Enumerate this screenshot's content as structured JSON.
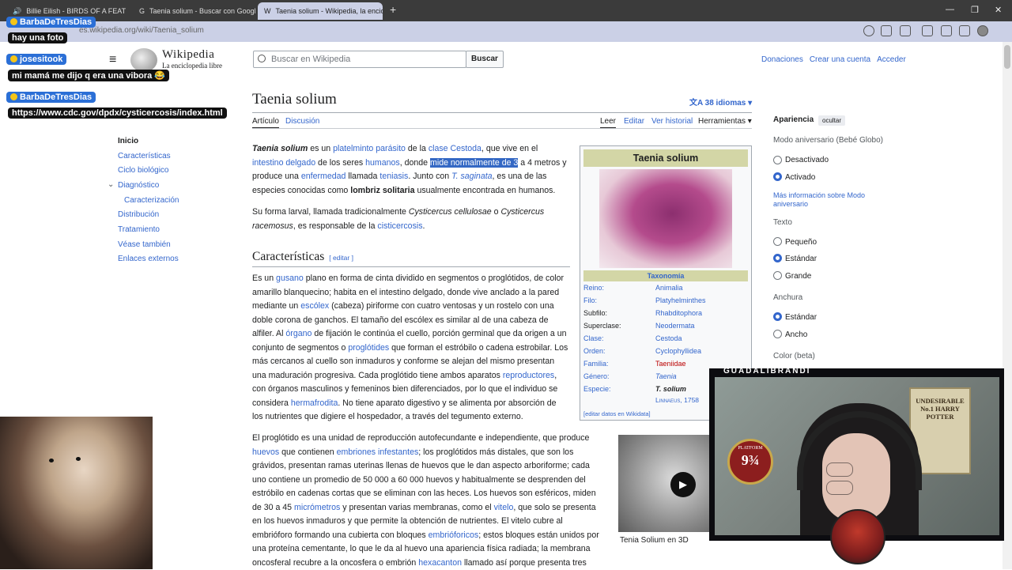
{
  "browser": {
    "tabs": [
      {
        "label": "Billie Eilish - BIRDS OF A FEAT",
        "close": "✕"
      },
      {
        "label": "Taenia solium - Buscar con Google",
        "close": "✕"
      },
      {
        "label": "Taenia solium - Wikipedia, la encic",
        "close": "✕"
      }
    ],
    "new_tab": "+",
    "url": "es.wikipedia.org/wiki/Taenia_solium",
    "window_controls": [
      "—",
      "❐",
      "✕"
    ]
  },
  "header": {
    "menu_glyph": "≡",
    "logo_word": "Wikipedia",
    "logo_tagline": "La enciclopedia libre",
    "search_placeholder": "Buscar en Wikipedia",
    "search_button": "Buscar",
    "links": [
      "Donaciones",
      "Crear una cuenta",
      "Acceder"
    ]
  },
  "article": {
    "title": "Taenia solium",
    "languages": "38 idiomas",
    "tabs_left": [
      "Artículo",
      "Discusión"
    ],
    "tabs_right": [
      "Leer",
      "Editar",
      "Ver historial",
      "Herramientas"
    ]
  },
  "toc": {
    "items": [
      "Inicio",
      "Características",
      "Ciclo biológico",
      "Diagnóstico",
      "Caracterización",
      "Distribución",
      "Tratamiento",
      "Véase también",
      "Enlaces externos"
    ]
  },
  "body": {
    "p1": {
      "a": "Taenia solium",
      "b": " es un ",
      "c": "platelminto parásito",
      "d": " de la ",
      "e": "clase Cestoda",
      "f": ", que vive en el ",
      "g": "intestino delgado",
      "h": " de los seres ",
      "i": "humanos",
      "j": ", donde ",
      "k": "mide normalmente de 3",
      "l": " a 4 metros y produce una ",
      "m": "enfermedad",
      "n": " llamada ",
      "o": "teniasis",
      "q": ". Junto con ",
      "r": "T. saginata",
      "s": ", es una de las especies conocidas como ",
      "t": "lombriz solitaria",
      "u": " usualmente encontrada en humanos."
    },
    "p2": {
      "a": "Su forma larval, llamada tradicionalmente ",
      "b": "Cysticercus cellulosae",
      "c": " o ",
      "d": "Cysticercus racemosus",
      "e": ", es responsable de la ",
      "f": "cisticercosis",
      "g": "."
    },
    "h2": "Características",
    "h2_edit": "[ editar ]",
    "p3": {
      "a": "Es un ",
      "b": "gusano",
      "c": " plano en forma de cinta dividido en segmentos o proglótidos, de color amarillo blanquecino; habita en el intestino delgado, donde vive anclado a la pared mediante un ",
      "d": "escólex",
      "e": " (cabeza) piriforme con cuatro ventosas y un rostelo con una doble corona de ganchos. El tamaño del escólex es similar al de una cabeza de alfiler. Al ",
      "f": "órgano",
      "g": " de fijación le continúa el cuello, porción germinal que da origen a un conjunto de segmentos o ",
      "h": "proglótides",
      "i": " que forman el estróbilo o cadena estrobilar. Los más cercanos al cuello son inmaduros y conforme se alejan del mismo presentan una maduración progresiva. Cada proglótido tiene ambos aparatos ",
      "j": "reproductores",
      "k": ", con órganos masculinos y femeninos bien diferenciados, por lo que el individuo se considera ",
      "l": "hermafrodita",
      "m": ". No tiene aparato digestivo y se alimenta por absorción de los nutrientes que digiere el hospedador, a través del tegumento externo."
    },
    "p4": {
      "a": "El proglótido es una unidad de reproducción autofecundante e independiente, que produce ",
      "b": "huevos",
      "c": " que contienen ",
      "d": "embriones infestantes",
      "e": "; los proglótidos más distales, que son los grávidos, presentan ramas uterinas llenas de huevos que le dan aspecto arboriforme; cada uno contiene un promedio de 50 000 a 60 000 huevos y habitualmente se desprenden del estróbilo en cadenas cortas que se eliminan con las heces. Los huevos son esféricos, miden de 30 a 45 ",
      "f": "micrómetros",
      "g": " y presentan varias membranas, como el ",
      "h": "vitelo",
      "i": ", que solo se presenta en los huevos inmaduros y que permite la obtención de nutrientes. El vitelo cubre al embrióforo formando una cubierta con bloques ",
      "j": "embrióforicos",
      "k": "; estos bloques están unidos por una proteína cementante, lo que le da al huevo una apariencia física radiada; la membrana oncosferal recubre a la oncosfera o embrión ",
      "l": "hexacanton",
      "m": " llamado así porque presenta tres"
    }
  },
  "infobox": {
    "title": "Taenia solium",
    "taxonomy": "Taxonomía",
    "rows": [
      {
        "k": "Reino:",
        "v": "Animalia"
      },
      {
        "k": "Filo:",
        "v": "Platyhelminthes"
      },
      {
        "k": "Subfilo:",
        "v": "Rhabditophora"
      },
      {
        "k": "Superclase:",
        "v": "Neodermata"
      },
      {
        "k": "Clase:",
        "v": "Cestoda"
      },
      {
        "k": "Orden:",
        "v": "Cyclophyllidea"
      },
      {
        "k": "Familia:",
        "v": "Taeniidae"
      },
      {
        "k": "Género:",
        "v": "Taenia"
      },
      {
        "k": "Especie:",
        "v": "T. solium"
      }
    ],
    "authority": "Linnaeus, 1758",
    "edit_link": "[editar datos en Wikidata]"
  },
  "video": {
    "caption": "Tenia Solium en 3D",
    "play": "▶"
  },
  "appearance": {
    "title": "Apariencia",
    "hide": "ocultar",
    "section1": "Modo aniversario (Bebé Globo)",
    "opt1": "Desactivado",
    "opt2": "Activado",
    "more_info": "Más información sobre Modo aniversario",
    "section2": "Texto",
    "text_opts": [
      "Pequeño",
      "Estándar",
      "Grande"
    ],
    "section3": "Anchura",
    "width_opts": [
      "Estándar",
      "Ancho"
    ],
    "section4": "Color (beta)"
  },
  "stream": {
    "chat": [
      {
        "user": "BarbaDeTresDias",
        "msg": "hay una foto"
      },
      {
        "user": "josesitook",
        "msg": "mi mamá me dijo q era una vibora 😂"
      },
      {
        "user": "BarbaDeTresDias",
        "msg": "https://www.cdc.gov/dpdx/cysticercosis/index.html"
      }
    ],
    "cam_label": "GUADALIBRANDI",
    "poster_text": "UNDESIRABLE No.1 HARRY POTTER",
    "platform_top": "PLATFORM",
    "platform_num": "9¾"
  },
  "colors": {
    "link": "#3366cc",
    "highlight": "#3468c4",
    "infobox_header": "#d3d6a6",
    "chrome": "#cbd0e6"
  }
}
